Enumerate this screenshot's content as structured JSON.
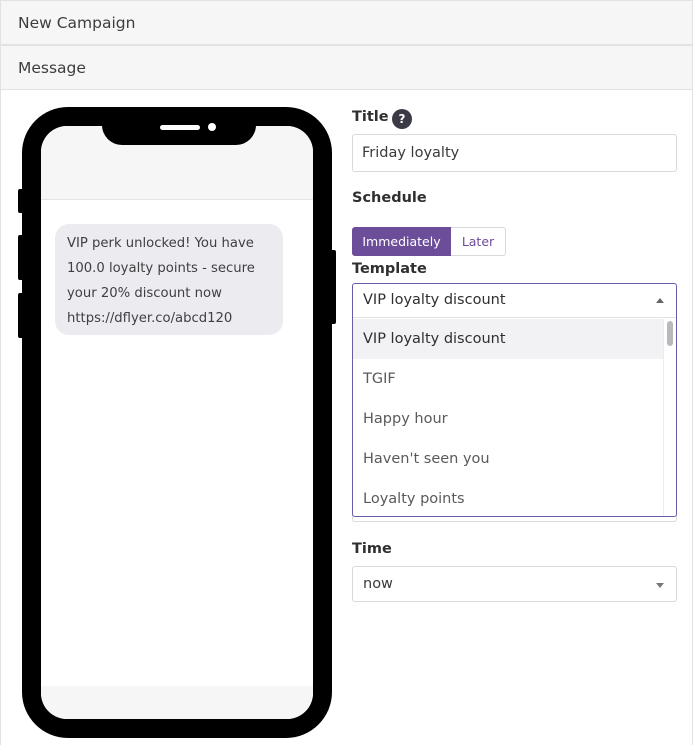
{
  "header": {
    "title": "New Campaign"
  },
  "section": {
    "title": "Message"
  },
  "phone_preview": {
    "message_lines": [
      "VIP perk unlocked! You have",
      "100.0 loyalty points - secure",
      "your 20% discount now",
      "https://dflyer.co/abcd120"
    ]
  },
  "form": {
    "title": {
      "label": "Title",
      "help_icon": "?",
      "value": "Friday loyalty"
    },
    "schedule": {
      "label": "Schedule",
      "options": [
        "Immediately",
        "Later"
      ],
      "selected": "Immediately"
    },
    "template": {
      "label": "Template",
      "selected": "VIP loyalty discount",
      "options": [
        "VIP loyalty discount",
        "TGIF",
        "Happy hour",
        "Haven't seen you",
        "Loyalty points"
      ]
    },
    "time": {
      "label": "Time",
      "value": "now"
    }
  },
  "colors": {
    "accent": "#6c4d9a",
    "focus_border": "#6a5aa8",
    "header_bg": "#f6f6f7"
  }
}
